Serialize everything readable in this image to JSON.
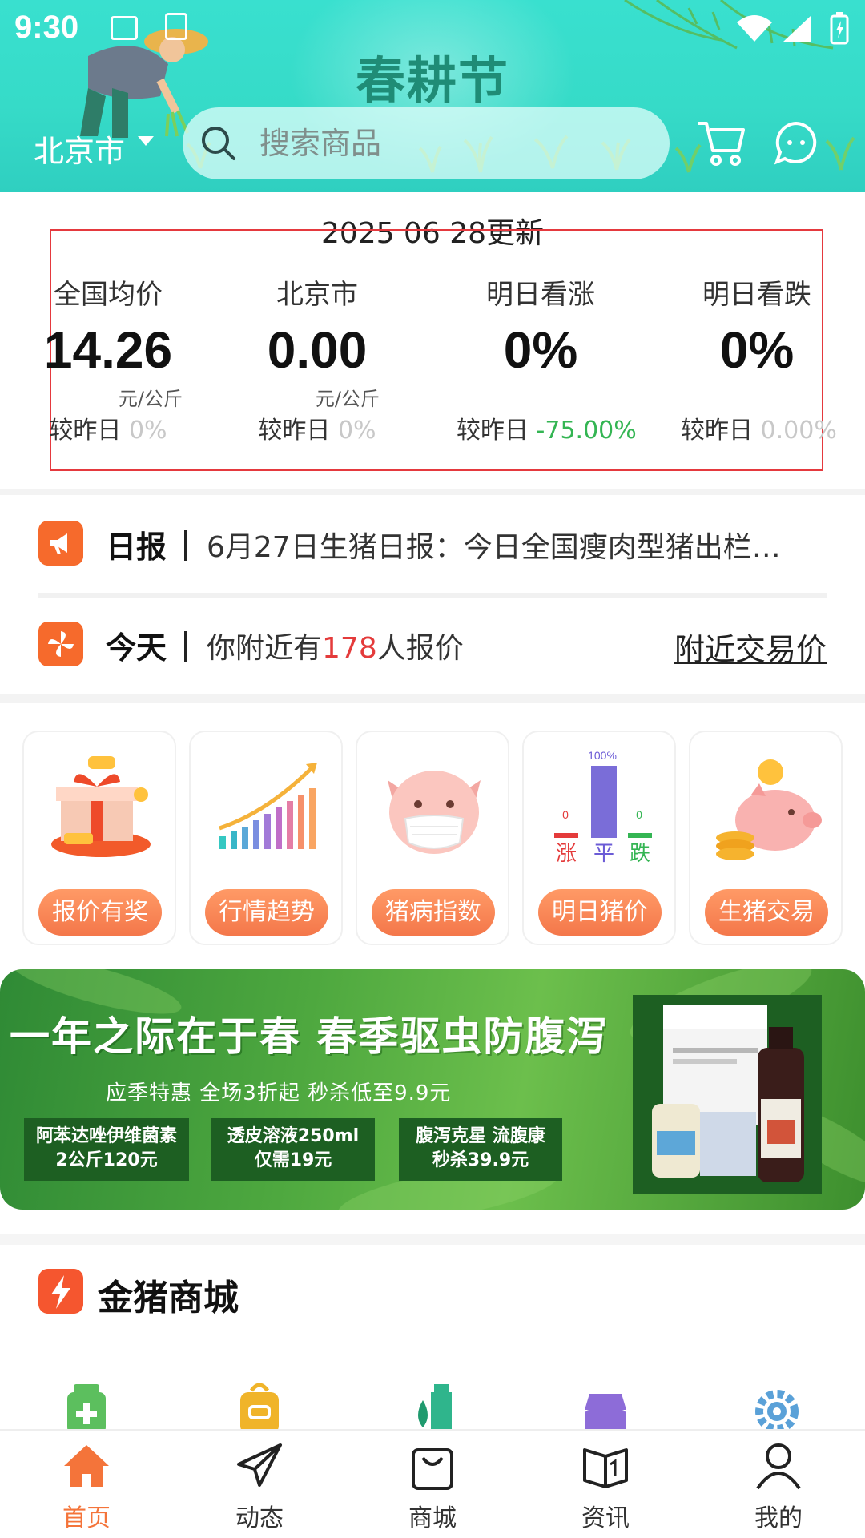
{
  "status_bar": {
    "time": "9:30"
  },
  "header": {
    "festival_title": "春耕节",
    "city": "北京市",
    "search_placeholder": "搜索商品"
  },
  "price_board": {
    "updated": "2025 06 28更新",
    "compare_label": "较昨日",
    "columns": [
      {
        "label": "全国均价",
        "value": "14.26",
        "unit": "元/公斤",
        "change": "0%",
        "change_color": "#c8c8c8"
      },
      {
        "label": "北京市",
        "value": "0.00",
        "unit": "元/公斤",
        "change": "0%",
        "change_color": "#c8c8c8"
      },
      {
        "label": "明日看涨",
        "value": "0%",
        "unit": "",
        "change": "-75.00%",
        "change_color": "#34b553"
      },
      {
        "label": "明日看跌",
        "value": "0%",
        "unit": "",
        "change": "0.00%",
        "change_color": "#c8c8c8"
      }
    ]
  },
  "daily_report": {
    "tag": "日报",
    "text": "6月27日生猪日报：今日全国瘦肉型猪出栏…"
  },
  "today": {
    "tag": "今天",
    "prefix": "你附近有",
    "count": "178",
    "suffix": "人报价",
    "link": "附近交易价"
  },
  "tiles": [
    {
      "label": "报价有奖"
    },
    {
      "label": "行情趋势"
    },
    {
      "label": "猪病指数"
    },
    {
      "label": "明日猪价",
      "rise_label": "涨",
      "flat_label": "平",
      "fall_label": "跌",
      "rise": "0",
      "flat": "100%",
      "fall": "0"
    },
    {
      "label": "生猪交易"
    }
  ],
  "banner": {
    "title": "一年之际在于春  春季驱虫防腹泻",
    "subtitle": "应季特惠  全场3折起  秒杀低至9.9元",
    "promos": [
      {
        "line1": "阿苯达唑伊维菌素",
        "line2": "2公斤120元"
      },
      {
        "line1": "透皮溶液250ml",
        "line2": "仅需19元"
      },
      {
        "line1": "腹泻克星 流腹康",
        "line2": "秒杀39.9元"
      }
    ]
  },
  "mall": {
    "title": "金猪商城"
  },
  "bottom_nav": [
    {
      "label": "首页",
      "icon": "home-icon",
      "active": true
    },
    {
      "label": "动态",
      "icon": "send-icon",
      "active": false
    },
    {
      "label": "商城",
      "icon": "shopping-bag-icon",
      "active": false
    },
    {
      "label": "资讯",
      "icon": "book-icon",
      "active": false
    },
    {
      "label": "我的",
      "icon": "user-icon",
      "active": false
    }
  ],
  "colors": {
    "accent": "#f4743a",
    "header": "#36dbc8",
    "green": "#34b553",
    "highlight": "#e43b3b"
  }
}
